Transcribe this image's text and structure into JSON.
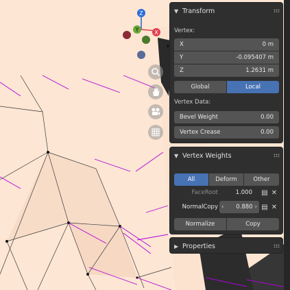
{
  "gizmo": {
    "axis_z": "Z",
    "axis_y": "Y",
    "axis_x": "X"
  },
  "nav_tools": [
    {
      "icon": "zoom-icon"
    },
    {
      "icon": "hand-icon"
    },
    {
      "icon": "camera-icon"
    },
    {
      "icon": "grid-icon"
    }
  ],
  "transform": {
    "title": "Transform",
    "section_label": "Vertex:",
    "fields": [
      {
        "label": "X",
        "value": "0 m"
      },
      {
        "label": "Y",
        "value": "-0.095407 m"
      },
      {
        "label": "Z",
        "value": "1.2631 m"
      }
    ],
    "space_options": [
      "Global",
      "Local"
    ],
    "space_selected": "Local",
    "data_label": "Vertex Data:",
    "data_fields": [
      {
        "label": "Bevel Weight",
        "value": "0.00"
      },
      {
        "label": "Vertex Crease",
        "value": "0.00"
      }
    ]
  },
  "vertex_weights": {
    "title": "Vertex Weights",
    "filters": [
      "All",
      "Deform",
      "Other"
    ],
    "filter_selected": "All",
    "groups": [
      {
        "name": "FaceRoot",
        "value": "1.000",
        "active": false
      },
      {
        "name": "NormalCopy",
        "value": "0.880",
        "active": true
      }
    ],
    "normalize_label": "Normalize",
    "copy_label": "Copy"
  },
  "properties": {
    "title": "Properties"
  },
  "colors": {
    "panel_bg": "#2f2f2f",
    "field_bg": "#545454",
    "accent": "#4772b3",
    "viewport_bg": "#fde7d5",
    "edge_highlight": "#b000e0"
  }
}
